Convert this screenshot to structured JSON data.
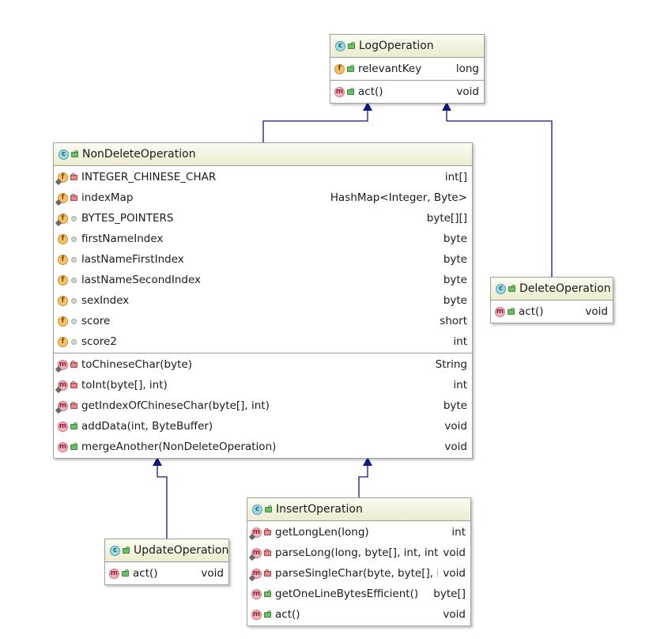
{
  "colors": {
    "edge": "#0d1880"
  },
  "classes": [
    {
      "id": "logop",
      "name": "LogOperation",
      "icon": "class-icon",
      "sections": [
        [
          {
            "kind": "f",
            "static": false,
            "vis": "public",
            "name": "relevantKey",
            "type": "long"
          }
        ],
        [
          {
            "kind": "m",
            "static": false,
            "vis": "public",
            "name": "act()",
            "type": "void"
          }
        ]
      ]
    },
    {
      "id": "nondel",
      "name": "NonDeleteOperation",
      "icon": "class-icon",
      "sections": [
        [
          {
            "kind": "f",
            "static": true,
            "vis": "private",
            "name": "INTEGER_CHINESE_CHAR",
            "type": "int[]"
          },
          {
            "kind": "f",
            "static": true,
            "vis": "private",
            "name": "indexMap",
            "type": "HashMap<Integer, Byte>"
          },
          {
            "kind": "f",
            "static": true,
            "vis": "package",
            "name": "BYTES_POINTERS",
            "type": "byte[][]"
          },
          {
            "kind": "f",
            "static": false,
            "vis": "package",
            "name": "firstNameIndex",
            "type": "byte"
          },
          {
            "kind": "f",
            "static": false,
            "vis": "package",
            "name": "lastNameFirstIndex",
            "type": "byte"
          },
          {
            "kind": "f",
            "static": false,
            "vis": "package",
            "name": "lastNameSecondIndex",
            "type": "byte"
          },
          {
            "kind": "f",
            "static": false,
            "vis": "package",
            "name": "sexIndex",
            "type": "byte"
          },
          {
            "kind": "f",
            "static": false,
            "vis": "package",
            "name": "score",
            "type": "short"
          },
          {
            "kind": "f",
            "static": false,
            "vis": "package",
            "name": "score2",
            "type": "int"
          }
        ],
        [
          {
            "kind": "m",
            "static": true,
            "vis": "private",
            "name": "toChineseChar(byte)",
            "type": "String"
          },
          {
            "kind": "m",
            "static": true,
            "vis": "private",
            "name": "toInt(byte[], int)",
            "type": "int"
          },
          {
            "kind": "m",
            "static": true,
            "vis": "private",
            "name": "getIndexOfChineseChar(byte[], int)",
            "type": "byte"
          },
          {
            "kind": "m",
            "static": false,
            "vis": "public",
            "name": "addData(int, ByteBuffer)",
            "type": "void"
          },
          {
            "kind": "m",
            "static": false,
            "vis": "public",
            "name": "mergeAnother(NonDeleteOperation)",
            "type": "void"
          }
        ]
      ]
    },
    {
      "id": "delop",
      "name": "DeleteOperation",
      "icon": "class-icon",
      "sections": [
        [
          {
            "kind": "m",
            "static": false,
            "vis": "public",
            "name": "act()",
            "type": "void"
          }
        ]
      ]
    },
    {
      "id": "updop",
      "name": "UpdateOperation",
      "icon": "class-icon",
      "sections": [
        [
          {
            "kind": "m",
            "static": false,
            "vis": "public",
            "name": "act()",
            "type": "void"
          }
        ]
      ]
    },
    {
      "id": "insop",
      "name": "InsertOperation",
      "icon": "class-icon",
      "sections": [
        [
          {
            "kind": "m",
            "static": true,
            "vis": "private",
            "name": "getLongLen(long)",
            "type": "int"
          },
          {
            "kind": "m",
            "static": true,
            "vis": "private",
            "name": "parseLong(long, byte[], int, int)",
            "type": "void"
          },
          {
            "kind": "m",
            "static": true,
            "vis": "private",
            "name": "parseSingleChar(byte, byte[], int)",
            "type": "void"
          },
          {
            "kind": "m",
            "static": false,
            "vis": "public",
            "name": "getOneLineBytesEfficient()",
            "type": "byte[]"
          },
          {
            "kind": "m",
            "static": false,
            "vis": "public",
            "name": "act()",
            "type": "void"
          }
        ]
      ]
    }
  ],
  "edges": [
    {
      "from": "NonDeleteOperation",
      "to": "LogOperation",
      "relation": "extends"
    },
    {
      "from": "DeleteOperation",
      "to": "LogOperation",
      "relation": "extends"
    },
    {
      "from": "UpdateOperation",
      "to": "NonDeleteOperation",
      "relation": "extends"
    },
    {
      "from": "InsertOperation",
      "to": "NonDeleteOperation",
      "relation": "extends"
    }
  ]
}
